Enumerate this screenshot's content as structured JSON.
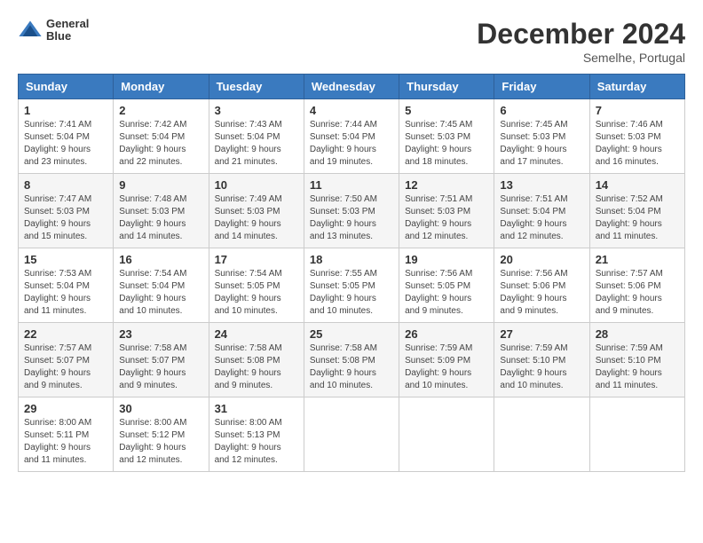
{
  "header": {
    "logo_line1": "General",
    "logo_line2": "Blue",
    "month_title": "December 2024",
    "location": "Semelhe, Portugal"
  },
  "weekdays": [
    "Sunday",
    "Monday",
    "Tuesday",
    "Wednesday",
    "Thursday",
    "Friday",
    "Saturday"
  ],
  "weeks": [
    [
      {
        "day": "1",
        "sunrise": "Sunrise: 7:41 AM",
        "sunset": "Sunset: 5:04 PM",
        "daylight": "Daylight: 9 hours and 23 minutes."
      },
      {
        "day": "2",
        "sunrise": "Sunrise: 7:42 AM",
        "sunset": "Sunset: 5:04 PM",
        "daylight": "Daylight: 9 hours and 22 minutes."
      },
      {
        "day": "3",
        "sunrise": "Sunrise: 7:43 AM",
        "sunset": "Sunset: 5:04 PM",
        "daylight": "Daylight: 9 hours and 21 minutes."
      },
      {
        "day": "4",
        "sunrise": "Sunrise: 7:44 AM",
        "sunset": "Sunset: 5:04 PM",
        "daylight": "Daylight: 9 hours and 19 minutes."
      },
      {
        "day": "5",
        "sunrise": "Sunrise: 7:45 AM",
        "sunset": "Sunset: 5:03 PM",
        "daylight": "Daylight: 9 hours and 18 minutes."
      },
      {
        "day": "6",
        "sunrise": "Sunrise: 7:45 AM",
        "sunset": "Sunset: 5:03 PM",
        "daylight": "Daylight: 9 hours and 17 minutes."
      },
      {
        "day": "7",
        "sunrise": "Sunrise: 7:46 AM",
        "sunset": "Sunset: 5:03 PM",
        "daylight": "Daylight: 9 hours and 16 minutes."
      }
    ],
    [
      {
        "day": "8",
        "sunrise": "Sunrise: 7:47 AM",
        "sunset": "Sunset: 5:03 PM",
        "daylight": "Daylight: 9 hours and 15 minutes."
      },
      {
        "day": "9",
        "sunrise": "Sunrise: 7:48 AM",
        "sunset": "Sunset: 5:03 PM",
        "daylight": "Daylight: 9 hours and 14 minutes."
      },
      {
        "day": "10",
        "sunrise": "Sunrise: 7:49 AM",
        "sunset": "Sunset: 5:03 PM",
        "daylight": "Daylight: 9 hours and 14 minutes."
      },
      {
        "day": "11",
        "sunrise": "Sunrise: 7:50 AM",
        "sunset": "Sunset: 5:03 PM",
        "daylight": "Daylight: 9 hours and 13 minutes."
      },
      {
        "day": "12",
        "sunrise": "Sunrise: 7:51 AM",
        "sunset": "Sunset: 5:03 PM",
        "daylight": "Daylight: 9 hours and 12 minutes."
      },
      {
        "day": "13",
        "sunrise": "Sunrise: 7:51 AM",
        "sunset": "Sunset: 5:04 PM",
        "daylight": "Daylight: 9 hours and 12 minutes."
      },
      {
        "day": "14",
        "sunrise": "Sunrise: 7:52 AM",
        "sunset": "Sunset: 5:04 PM",
        "daylight": "Daylight: 9 hours and 11 minutes."
      }
    ],
    [
      {
        "day": "15",
        "sunrise": "Sunrise: 7:53 AM",
        "sunset": "Sunset: 5:04 PM",
        "daylight": "Daylight: 9 hours and 11 minutes."
      },
      {
        "day": "16",
        "sunrise": "Sunrise: 7:54 AM",
        "sunset": "Sunset: 5:04 PM",
        "daylight": "Daylight: 9 hours and 10 minutes."
      },
      {
        "day": "17",
        "sunrise": "Sunrise: 7:54 AM",
        "sunset": "Sunset: 5:05 PM",
        "daylight": "Daylight: 9 hours and 10 minutes."
      },
      {
        "day": "18",
        "sunrise": "Sunrise: 7:55 AM",
        "sunset": "Sunset: 5:05 PM",
        "daylight": "Daylight: 9 hours and 10 minutes."
      },
      {
        "day": "19",
        "sunrise": "Sunrise: 7:56 AM",
        "sunset": "Sunset: 5:05 PM",
        "daylight": "Daylight: 9 hours and 9 minutes."
      },
      {
        "day": "20",
        "sunrise": "Sunrise: 7:56 AM",
        "sunset": "Sunset: 5:06 PM",
        "daylight": "Daylight: 9 hours and 9 minutes."
      },
      {
        "day": "21",
        "sunrise": "Sunrise: 7:57 AM",
        "sunset": "Sunset: 5:06 PM",
        "daylight": "Daylight: 9 hours and 9 minutes."
      }
    ],
    [
      {
        "day": "22",
        "sunrise": "Sunrise: 7:57 AM",
        "sunset": "Sunset: 5:07 PM",
        "daylight": "Daylight: 9 hours and 9 minutes."
      },
      {
        "day": "23",
        "sunrise": "Sunrise: 7:58 AM",
        "sunset": "Sunset: 5:07 PM",
        "daylight": "Daylight: 9 hours and 9 minutes."
      },
      {
        "day": "24",
        "sunrise": "Sunrise: 7:58 AM",
        "sunset": "Sunset: 5:08 PM",
        "daylight": "Daylight: 9 hours and 9 minutes."
      },
      {
        "day": "25",
        "sunrise": "Sunrise: 7:58 AM",
        "sunset": "Sunset: 5:08 PM",
        "daylight": "Daylight: 9 hours and 10 minutes."
      },
      {
        "day": "26",
        "sunrise": "Sunrise: 7:59 AM",
        "sunset": "Sunset: 5:09 PM",
        "daylight": "Daylight: 9 hours and 10 minutes."
      },
      {
        "day": "27",
        "sunrise": "Sunrise: 7:59 AM",
        "sunset": "Sunset: 5:10 PM",
        "daylight": "Daylight: 9 hours and 10 minutes."
      },
      {
        "day": "28",
        "sunrise": "Sunrise: 7:59 AM",
        "sunset": "Sunset: 5:10 PM",
        "daylight": "Daylight: 9 hours and 11 minutes."
      }
    ],
    [
      {
        "day": "29",
        "sunrise": "Sunrise: 8:00 AM",
        "sunset": "Sunset: 5:11 PM",
        "daylight": "Daylight: 9 hours and 11 minutes."
      },
      {
        "day": "30",
        "sunrise": "Sunrise: 8:00 AM",
        "sunset": "Sunset: 5:12 PM",
        "daylight": "Daylight: 9 hours and 12 minutes."
      },
      {
        "day": "31",
        "sunrise": "Sunrise: 8:00 AM",
        "sunset": "Sunset: 5:13 PM",
        "daylight": "Daylight: 9 hours and 12 minutes."
      },
      null,
      null,
      null,
      null
    ]
  ]
}
